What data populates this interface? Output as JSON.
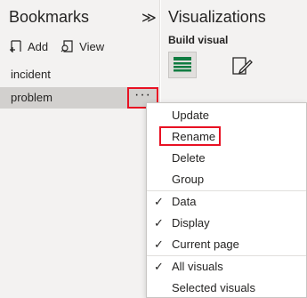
{
  "bookmarks": {
    "title": "Bookmarks",
    "collapse_glyph": "≫",
    "add_label": "Add",
    "view_label": "View",
    "items": [
      {
        "label": "incident"
      },
      {
        "label": "problem"
      }
    ],
    "more_glyph": "···"
  },
  "visualizations": {
    "title": "Visualizations",
    "build_label": "Build visual"
  },
  "menu": {
    "group1": [
      {
        "label": "Update"
      },
      {
        "label": "Rename"
      },
      {
        "label": "Delete"
      },
      {
        "label": "Group"
      }
    ],
    "group2": [
      {
        "label": "Data",
        "checked": true
      },
      {
        "label": "Display",
        "checked": true
      },
      {
        "label": "Current page",
        "checked": true
      }
    ],
    "group3": [
      {
        "label": "All visuals",
        "checked": true
      },
      {
        "label": "Selected visuals",
        "checked": false
      }
    ],
    "check_glyph": "✓"
  },
  "colors": {
    "highlight": "#e81123",
    "pane_bg": "#f3f2f1",
    "selected_bg": "#d2d0ce"
  }
}
